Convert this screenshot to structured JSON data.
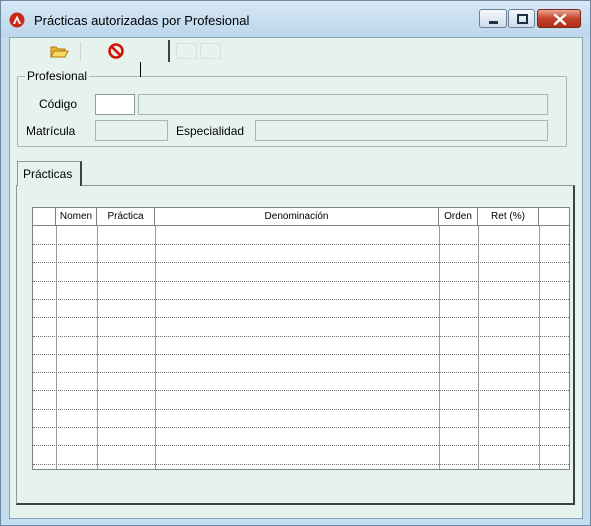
{
  "window": {
    "title": "Prácticas autorizadas por Profesional",
    "accent": "#c3432b"
  },
  "toolbar": {
    "open_icon": "folder-open-icon",
    "cancel_icon": "no-entry-icon"
  },
  "profesional": {
    "legend": "Profesional",
    "codigo_label": "Código",
    "codigo_value": "",
    "nombre_value": "",
    "matricula_label": "Matrícula",
    "matricula_value": "",
    "especialidad_label": "Especialidad",
    "especialidad_value": ""
  },
  "tabs": [
    {
      "label": "Prácticas"
    }
  ],
  "grid": {
    "columns": [
      "",
      "Nomen",
      "Práctica",
      "Denominación",
      "Orden",
      "Ret (%)",
      ""
    ],
    "row_count": 13
  }
}
